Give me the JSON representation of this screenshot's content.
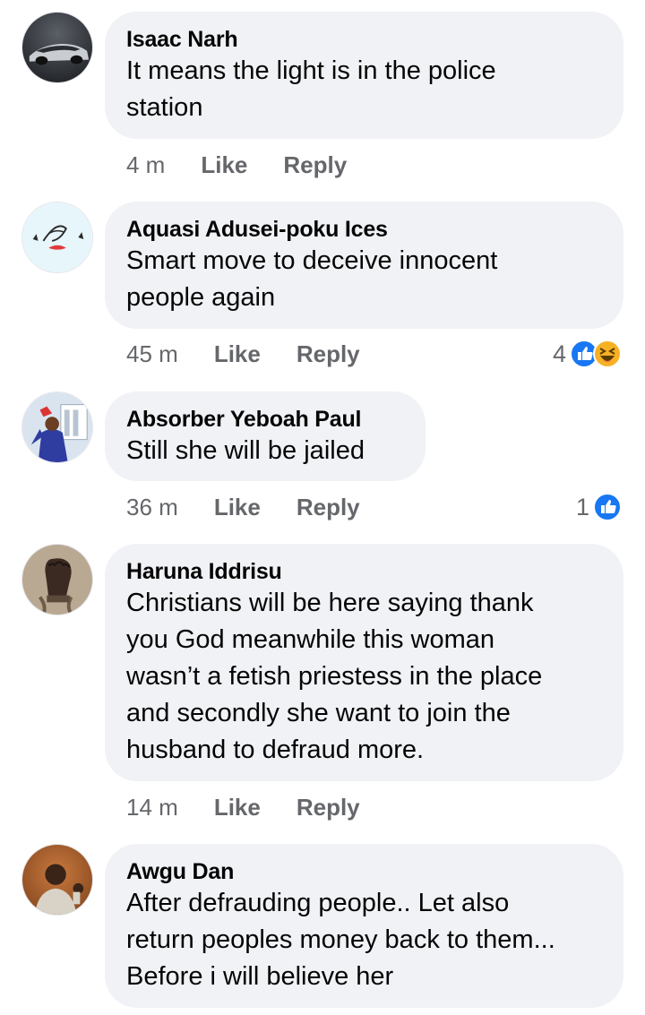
{
  "comments": [
    {
      "name": "Isaac Narh",
      "text": "It means the light is in the police\nstation",
      "time": "4 m",
      "like_label": "Like",
      "reply_label": "Reply",
      "reaction_count": "",
      "avatar_icon": "car-avatar"
    },
    {
      "name": "Aquasi Adusei-poku Ices",
      "text": "Smart move to deceive innocent\npeople again",
      "time": "45 m",
      "like_label": "Like",
      "reply_label": "Reply",
      "reaction_count": "4",
      "reactions": [
        "like-reaction-icon",
        "haha-reaction-icon"
      ],
      "avatar_icon": "logo-avatar"
    },
    {
      "name": "Absorber Yeboah Paul",
      "text": "Still she will be jailed",
      "time": "36 m",
      "like_label": "Like",
      "reply_label": "Reply",
      "reaction_count": "1",
      "reactions": [
        "like-reaction-icon"
      ],
      "avatar_icon": "graduate-avatar"
    },
    {
      "name": "Haruna Iddrisu",
      "text": "Christians will be here saying thank\nyou God meanwhile this woman\nwasn’t a fetish priestess in the place\nand secondly she want to join the\nhusband to defraud more.",
      "time": "14 m",
      "like_label": "Like",
      "reply_label": "Reply",
      "reaction_count": "",
      "avatar_icon": "fist-avatar"
    },
    {
      "name": "Awgu Dan",
      "text": "After defrauding people.. Let also\nreturn peoples money back to them...\nBefore i will believe her",
      "time": "",
      "like_label": "",
      "reply_label": "",
      "reaction_count": "",
      "avatar_icon": "person-avatar"
    }
  ],
  "colors": {
    "bubble": "#f0f2f5",
    "meta_text": "#65676b",
    "like_blue": "#1877f2",
    "haha_yellow": "#f7b125"
  }
}
